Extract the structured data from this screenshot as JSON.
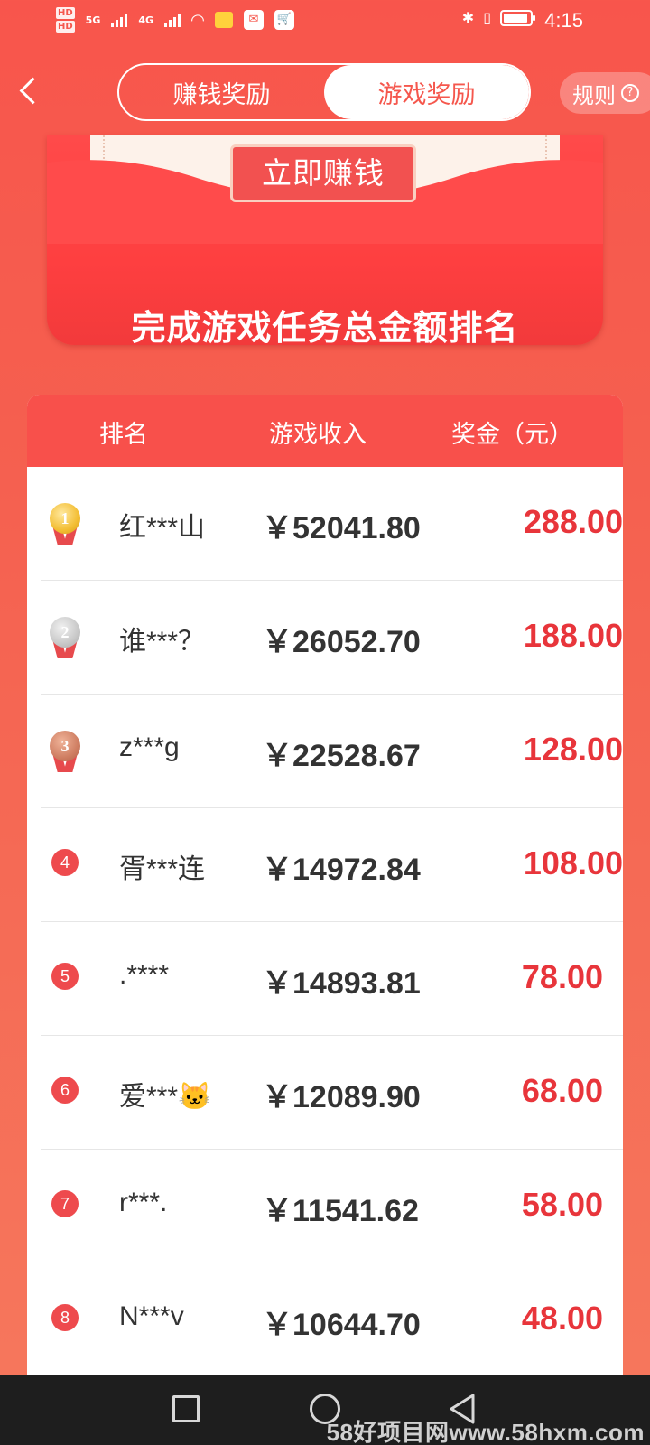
{
  "status_bar": {
    "hd1": "HD",
    "hd2": "HD",
    "net1": "5G",
    "net2": "4G",
    "time": "4:15"
  },
  "header": {
    "tabs": [
      {
        "label": "赚钱奖励",
        "active": false
      },
      {
        "label": "游戏奖励",
        "active": true
      }
    ],
    "rules_label": "规则",
    "help_glyph": "?"
  },
  "banner": {
    "button_label": "立即赚钱",
    "title": "完成游戏任务总金额排名"
  },
  "table": {
    "headers": {
      "rank": "排名",
      "income": "游戏收入",
      "bonus": "奖金（元）"
    },
    "rows": [
      {
        "rank": "1",
        "name": "红***山",
        "income": "￥52041.80",
        "bonus": "288.00",
        "medal": "gold"
      },
      {
        "rank": "2",
        "name": "谁***？",
        "income": "￥26052.70",
        "bonus": "188.00",
        "medal": "silver"
      },
      {
        "rank": "3",
        "name": "z***g",
        "income": "￥22528.67",
        "bonus": "128.00",
        "medal": "bronze"
      },
      {
        "rank": "4",
        "name": "胥***连",
        "income": "￥14972.84",
        "bonus": "108.00"
      },
      {
        "rank": "5",
        "name": ".****",
        "income": "￥14893.81",
        "bonus": "78.00"
      },
      {
        "rank": "6",
        "name": "爱***🐱",
        "income": "￥12089.90",
        "bonus": "68.00"
      },
      {
        "rank": "7",
        "name": "r***.",
        "income": "￥11541.62",
        "bonus": "58.00"
      },
      {
        "rank": "8",
        "name": "N***v",
        "income": "￥10644.70",
        "bonus": "48.00"
      }
    ]
  },
  "colors": {
    "brand_red": "#f5574d",
    "bonus_red": "#e8353b"
  },
  "watermark": "58好项目网www.58hxm.com"
}
